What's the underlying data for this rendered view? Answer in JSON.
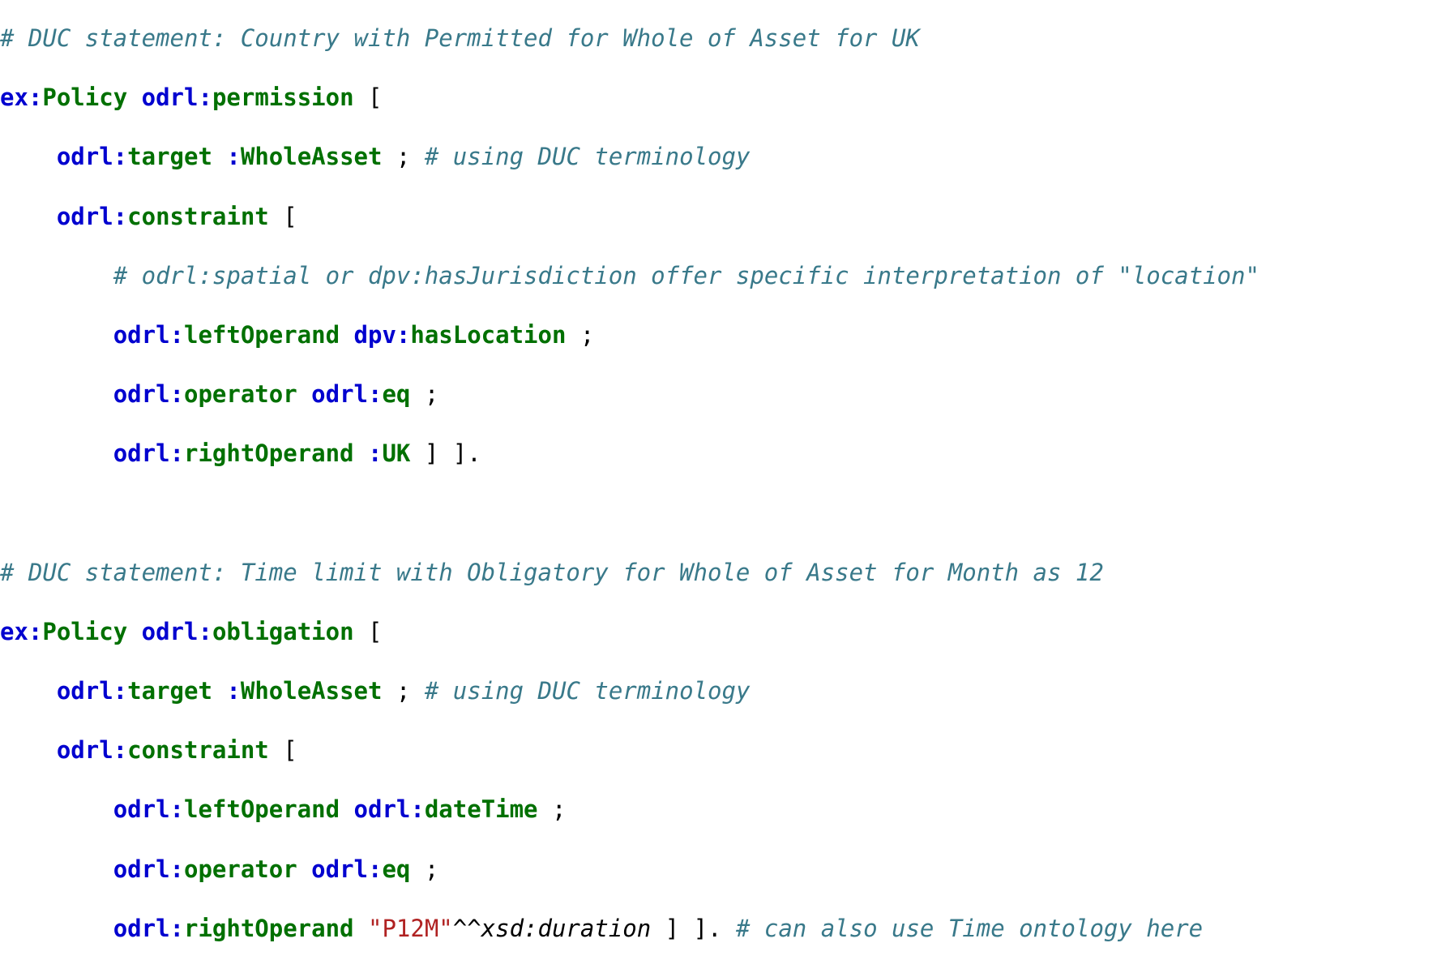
{
  "code_block": {
    "language": "turtle",
    "colors": {
      "comment": "#39798a",
      "prefix": "#0000cf",
      "local_name": "#007000",
      "punctuation": "#000000",
      "string_literal": "#b02222",
      "datatype": "#000000",
      "background": "#ffffff"
    },
    "lines": [
      {
        "index": 1,
        "text": "# DUC statement: Country with Permitted for Whole of Asset for UK",
        "tokens": [
          {
            "kind": "comment",
            "text": "# DUC statement: Country with Permitted for Whole of Asset for UK"
          }
        ]
      },
      {
        "index": 2,
        "text": "ex:Policy odrl:permission [",
        "tokens": [
          {
            "kind": "prefix",
            "text": "ex:"
          },
          {
            "kind": "name",
            "text": "Policy"
          },
          {
            "kind": "plain",
            "text": " "
          },
          {
            "kind": "prefix",
            "text": "odrl:"
          },
          {
            "kind": "name",
            "text": "permission"
          },
          {
            "kind": "punct",
            "text": " ["
          }
        ]
      },
      {
        "index": 3,
        "text": "    odrl:target :WholeAsset ; # using DUC terminology",
        "tokens": [
          {
            "kind": "plain",
            "text": "    "
          },
          {
            "kind": "prefix",
            "text": "odrl:"
          },
          {
            "kind": "name",
            "text": "target"
          },
          {
            "kind": "plain",
            "text": " "
          },
          {
            "kind": "prefix",
            "text": ":"
          },
          {
            "kind": "name",
            "text": "WholeAsset"
          },
          {
            "kind": "punct",
            "text": " ; "
          },
          {
            "kind": "comment",
            "text": "# using DUC terminology"
          }
        ]
      },
      {
        "index": 4,
        "text": "    odrl:constraint [",
        "tokens": [
          {
            "kind": "plain",
            "text": "    "
          },
          {
            "kind": "prefix",
            "text": "odrl:"
          },
          {
            "kind": "name",
            "text": "constraint"
          },
          {
            "kind": "punct",
            "text": " ["
          }
        ]
      },
      {
        "index": 5,
        "text": "        # odrl:spatial or dpv:hasJurisdiction offer specific interpretation of \"location\"",
        "tokens": [
          {
            "kind": "plain",
            "text": "        "
          },
          {
            "kind": "comment",
            "text": "# odrl:spatial or dpv:hasJurisdiction offer specific interpretation of \"location\""
          }
        ]
      },
      {
        "index": 6,
        "text": "        odrl:leftOperand dpv:hasLocation ;",
        "tokens": [
          {
            "kind": "plain",
            "text": "        "
          },
          {
            "kind": "prefix",
            "text": "odrl:"
          },
          {
            "kind": "name",
            "text": "leftOperand"
          },
          {
            "kind": "plain",
            "text": " "
          },
          {
            "kind": "prefix",
            "text": "dpv:"
          },
          {
            "kind": "name",
            "text": "hasLocation"
          },
          {
            "kind": "punct",
            "text": " ;"
          }
        ]
      },
      {
        "index": 7,
        "text": "        odrl:operator odrl:eq ;",
        "tokens": [
          {
            "kind": "plain",
            "text": "        "
          },
          {
            "kind": "prefix",
            "text": "odrl:"
          },
          {
            "kind": "name",
            "text": "operator"
          },
          {
            "kind": "plain",
            "text": " "
          },
          {
            "kind": "prefix",
            "text": "odrl:"
          },
          {
            "kind": "name",
            "text": "eq"
          },
          {
            "kind": "punct",
            "text": " ;"
          }
        ]
      },
      {
        "index": 8,
        "text": "        odrl:rightOperand :UK ] ].",
        "tokens": [
          {
            "kind": "plain",
            "text": "        "
          },
          {
            "kind": "prefix",
            "text": "odrl:"
          },
          {
            "kind": "name",
            "text": "rightOperand"
          },
          {
            "kind": "plain",
            "text": " "
          },
          {
            "kind": "prefix",
            "text": ":"
          },
          {
            "kind": "name",
            "text": "UK"
          },
          {
            "kind": "punct",
            "text": " ] ]."
          }
        ]
      },
      {
        "index": 9,
        "text": "",
        "tokens": [
          {
            "kind": "blank",
            "text": " "
          }
        ]
      },
      {
        "index": 10,
        "text": "# DUC statement: Time limit with Obligatory for Whole of Asset for Month as 12",
        "tokens": [
          {
            "kind": "comment",
            "text": "# DUC statement: Time limit with Obligatory for Whole of Asset for Month as 12"
          }
        ]
      },
      {
        "index": 11,
        "text": "ex:Policy odrl:obligation [",
        "tokens": [
          {
            "kind": "prefix",
            "text": "ex:"
          },
          {
            "kind": "name",
            "text": "Policy"
          },
          {
            "kind": "plain",
            "text": " "
          },
          {
            "kind": "prefix",
            "text": "odrl:"
          },
          {
            "kind": "name",
            "text": "obligation"
          },
          {
            "kind": "punct",
            "text": " ["
          }
        ]
      },
      {
        "index": 12,
        "text": "    odrl:target :WholeAsset ; # using DUC terminology",
        "tokens": [
          {
            "kind": "plain",
            "text": "    "
          },
          {
            "kind": "prefix",
            "text": "odrl:"
          },
          {
            "kind": "name",
            "text": "target"
          },
          {
            "kind": "plain",
            "text": " "
          },
          {
            "kind": "prefix",
            "text": ":"
          },
          {
            "kind": "name",
            "text": "WholeAsset"
          },
          {
            "kind": "punct",
            "text": " ; "
          },
          {
            "kind": "comment",
            "text": "# using DUC terminology"
          }
        ]
      },
      {
        "index": 13,
        "text": "    odrl:constraint [",
        "tokens": [
          {
            "kind": "plain",
            "text": "    "
          },
          {
            "kind": "prefix",
            "text": "odrl:"
          },
          {
            "kind": "name",
            "text": "constraint"
          },
          {
            "kind": "punct",
            "text": " ["
          }
        ]
      },
      {
        "index": 14,
        "text": "        odrl:leftOperand odrl:dateTime ;",
        "tokens": [
          {
            "kind": "plain",
            "text": "        "
          },
          {
            "kind": "prefix",
            "text": "odrl:"
          },
          {
            "kind": "name",
            "text": "leftOperand"
          },
          {
            "kind": "plain",
            "text": " "
          },
          {
            "kind": "prefix",
            "text": "odrl:"
          },
          {
            "kind": "name",
            "text": "dateTime"
          },
          {
            "kind": "punct",
            "text": " ;"
          }
        ]
      },
      {
        "index": 15,
        "text": "        odrl:operator odrl:eq ;",
        "tokens": [
          {
            "kind": "plain",
            "text": "        "
          },
          {
            "kind": "prefix",
            "text": "odrl:"
          },
          {
            "kind": "name",
            "text": "operator"
          },
          {
            "kind": "plain",
            "text": " "
          },
          {
            "kind": "prefix",
            "text": "odrl:"
          },
          {
            "kind": "name",
            "text": "eq"
          },
          {
            "kind": "punct",
            "text": " ;"
          }
        ]
      },
      {
        "index": 16,
        "text": "        odrl:rightOperand \"P12M\"^^xsd:duration ] ]. # can also use Time ontology here",
        "tokens": [
          {
            "kind": "plain",
            "text": "        "
          },
          {
            "kind": "prefix",
            "text": "odrl:"
          },
          {
            "kind": "name",
            "text": "rightOperand"
          },
          {
            "kind": "plain",
            "text": " "
          },
          {
            "kind": "string",
            "text": "\"P12M\""
          },
          {
            "kind": "punct",
            "text": "^^"
          },
          {
            "kind": "datatype",
            "text": "xsd:duration"
          },
          {
            "kind": "punct",
            "text": " ] ]. "
          },
          {
            "kind": "comment",
            "text": "# can also use Time ontology here"
          }
        ]
      }
    ]
  }
}
